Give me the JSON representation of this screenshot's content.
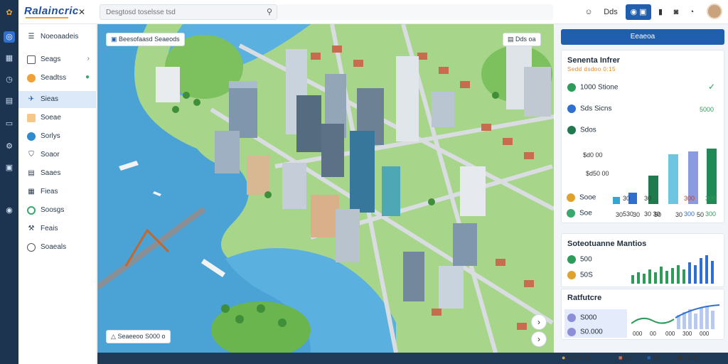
{
  "app": {
    "logo": "Ralaincric",
    "search_placeholder": "Desgtosd toselsse tsd"
  },
  "rail_icons": [
    "flower-icon",
    "location-icon",
    "grid-icon",
    "clock-icon",
    "layers-icon",
    "file-icon",
    "settings-icon",
    "image-icon",
    "eye-icon"
  ],
  "topbar": {
    "btn_text": "Dds",
    "colors": {
      "accent": "#1f5fae"
    }
  },
  "sidebar": {
    "header": "Noeoaadeis",
    "items": [
      {
        "label": "Seags",
        "icon": "box-icon",
        "color": "#555555"
      },
      {
        "label": "Seadtss",
        "icon": "circle-icon",
        "color": "#f0a23a"
      },
      {
        "label": "Sieas",
        "icon": "plane-icon",
        "color": "#1f5fae"
      },
      {
        "label": "Soeae",
        "icon": "tag-icon",
        "color": "#e0892e"
      },
      {
        "label": "Sorlys",
        "icon": "circle-icon",
        "color": "#2e8bd0"
      },
      {
        "label": "Soaor",
        "icon": "shield-icon",
        "color": "#555555"
      },
      {
        "label": "Saaes",
        "icon": "doc-icon",
        "color": "#555555"
      },
      {
        "label": "Fieas",
        "icon": "chart-icon",
        "color": "#555555"
      },
      {
        "label": "Soosgs",
        "icon": "circle-icon",
        "color": "#3aa76d"
      },
      {
        "label": "Feais",
        "icon": "tools-icon",
        "color": "#555555"
      },
      {
        "label": "Soaeals",
        "icon": "circle-outline-icon",
        "color": "#555555"
      }
    ]
  },
  "map": {
    "top_label": "Beesofaasd Seaeods",
    "top_right_label": "Dds oa",
    "bottom_label": "Seaeeoo S000 o"
  },
  "panel": {
    "primary_button": "Eeaeoa",
    "card1": {
      "title": "Senenta Infrer",
      "subtitle": "Sedd dsdoo 0:15",
      "rows": [
        {
          "icon_color": "#2e9b5a",
          "label": "1000 Stione"
        },
        {
          "icon_color": "#2e6fd0",
          "label": "Sds Sicns",
          "value": "5000"
        },
        {
          "icon_color": "#1f7a4d",
          "label": "Sdos"
        }
      ],
      "ylabels": [
        "$d0 00",
        "$d50 00"
      ],
      "x_labels": [
        "30",
        "30",
        "50",
        "30",
        "50"
      ],
      "bottom_rows": [
        {
          "icon_color": "#e0a22e",
          "label": "Sooe",
          "values": [
            "30",
            "30",
            "300",
            "300"
          ]
        },
        {
          "icon_color": "#3aa76d",
          "label": "Soe",
          "values": [
            "530",
            "30 30",
            "300",
            "300"
          ]
        }
      ]
    },
    "card2": {
      "title": "Soteotuanne Mantios",
      "rows": [
        {
          "icon_color": "#2e9b5a",
          "label": "500"
        },
        {
          "icon_color": "#e0a22e",
          "label": "50S"
        }
      ]
    },
    "card3": {
      "title": "Ratfutcre",
      "rows": [
        {
          "icon_color": "#8c8fd8",
          "label": "S000"
        },
        {
          "icon_color": "#8c8fd8",
          "label": "S0.000"
        }
      ],
      "x_labels": [
        "000",
        "00",
        "000",
        "300",
        "000"
      ]
    },
    "footer": [
      "000 000",
      "00",
      "00",
      "0000"
    ]
  }
}
